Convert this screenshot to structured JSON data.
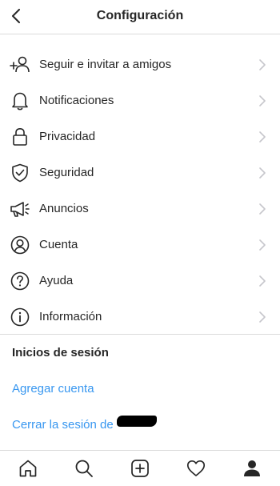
{
  "header": {
    "title": "Configuración",
    "back_icon": "chevron-left-icon"
  },
  "menu": [
    {
      "label": "Seguir e invitar a amigos",
      "icon": "add-person-icon"
    },
    {
      "label": "Notificaciones",
      "icon": "bell-icon"
    },
    {
      "label": "Privacidad",
      "icon": "lock-icon"
    },
    {
      "label": "Seguridad",
      "icon": "shield-check-icon"
    },
    {
      "label": "Anuncios",
      "icon": "megaphone-icon"
    },
    {
      "label": "Cuenta",
      "icon": "account-circle-icon"
    },
    {
      "label": "Ayuda",
      "icon": "help-circle-icon"
    },
    {
      "label": "Información",
      "icon": "info-circle-icon"
    }
  ],
  "logins": {
    "title": "Inicios de sesión",
    "add_account": "Agregar cuenta",
    "logout": "Cerrar la sesión de"
  },
  "tabbar": [
    "home-icon",
    "search-icon",
    "new-post-icon",
    "activity-heart-icon",
    "profile-icon"
  ],
  "colors": {
    "link": "#3897f0",
    "text": "#262626",
    "divider": "#dbdbdb",
    "chevron": "#c7c7cc"
  }
}
